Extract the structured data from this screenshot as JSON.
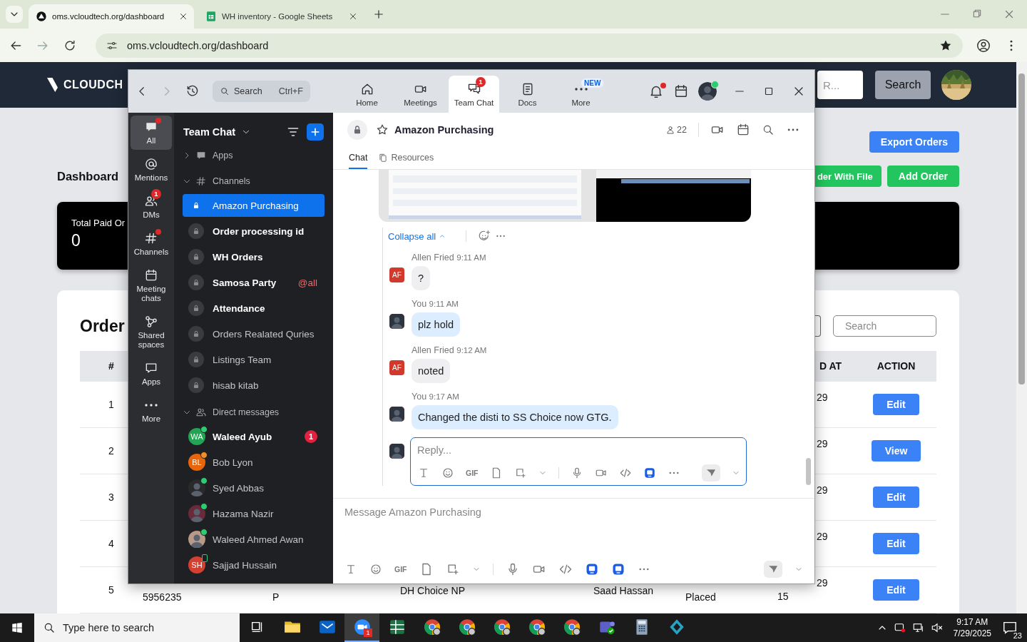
{
  "browser": {
    "tabs": [
      {
        "title": "oms.vcloudtech.org/dashboard",
        "selected": true
      },
      {
        "title": "WH inventory - Google Sheets",
        "selected": false
      }
    ],
    "address": "oms.vcloudtech.org/dashboard",
    "bookmarked": true
  },
  "dashboard": {
    "logo": "CLOUDCH",
    "header_search": {
      "placeholder": "R..."
    },
    "search_button": "Search",
    "title": "Dashboard",
    "buttons": [
      {
        "label": "Export Orders",
        "kind": "primary"
      },
      {
        "label": "der With File",
        "kind": "success"
      },
      {
        "label": "Add Order",
        "kind": "success"
      }
    ],
    "stat": {
      "label": "Total Paid Or",
      "value": "0"
    },
    "orders": {
      "title": "Order",
      "search": {
        "placeholder": "Search"
      },
      "columns": {
        "index": "#",
        "column_7": "D AT",
        "action": "ACTION"
      },
      "rows": [
        {
          "index": "1",
          "date": "29",
          "action": "Edit"
        },
        {
          "index": "2",
          "date": "29",
          "action": "View"
        },
        {
          "index": "3",
          "date": "29",
          "action": "Edit"
        },
        {
          "index": "4",
          "date": "29",
          "action": "Edit"
        },
        {
          "index": "5",
          "column_2": "5956235",
          "column_3": "P",
          "column_4": "DH Choice NP",
          "column_5": "Saad Hassan",
          "column_6": "Placed",
          "date": "29",
          "date_line_2": "15",
          "action": "Edit"
        }
      ]
    }
  },
  "zoom": {
    "titlebar": {
      "search": {
        "placeholder": "Search",
        "shortcut": "Ctrl+F"
      },
      "tabs": [
        {
          "label": "Home",
          "selected": false
        },
        {
          "label": "Meetings",
          "selected": false
        },
        {
          "label": "Team Chat",
          "selected": true,
          "badge": "1"
        },
        {
          "label": "Docs",
          "selected": false
        },
        {
          "label": "More",
          "selected": false,
          "tag": "NEW"
        }
      ],
      "notification_dot": true,
      "presence": {
        "kind": "dot",
        "color": "#2ecc71"
      }
    },
    "rail": [
      {
        "label": "All",
        "selected": true,
        "dot": true
      },
      {
        "label": "Mentions",
        "selected": false,
        "dot": false
      },
      {
        "label": "DMs",
        "selected": false,
        "dot": false,
        "badge": "1"
      },
      {
        "label": "Channels",
        "selected": false,
        "dot": true
      },
      {
        "label": "Meeting chats",
        "selected": false,
        "dot": false
      },
      {
        "label": "Shared spaces",
        "selected": false,
        "dot": false
      },
      {
        "label": "Apps",
        "selected": false,
        "dot": false
      },
      {
        "label": "More",
        "selected": false,
        "dot": false
      }
    ],
    "sidebar": {
      "title": "Team Chat",
      "sections": [
        {
          "label": "Apps",
          "expanded": false
        },
        {
          "label": "Channels",
          "expanded": true,
          "children": [
            {
              "name": "Amazon Purchasing",
              "selected": true,
              "unread": false
            },
            {
              "name": "Order processing id",
              "selected": false,
              "unread": true
            },
            {
              "name": "WH Orders",
              "selected": false,
              "unread": true
            },
            {
              "name": "Samosa Party",
              "selected": false,
              "unread": true,
              "mention": "@all"
            },
            {
              "name": "Attendance",
              "selected": false,
              "unread": true
            },
            {
              "name": "Orders Realated Quries",
              "selected": false,
              "unread": false
            },
            {
              "name": "Listings Team",
              "selected": false,
              "unread": false
            },
            {
              "name": "hisab kitab",
              "selected": false,
              "unread": false
            }
          ]
        },
        {
          "label": "Direct messages",
          "expanded": true,
          "children": [
            {
              "name": "Waleed Ayub",
              "initials": "WA",
              "color": "#23a455",
              "presence": {
                "kind": "dot",
                "color": "#2ecc71"
              },
              "selected": false,
              "unread": true,
              "badge": "1"
            },
            {
              "name": "Bob Lyon",
              "initials": "BL",
              "color": "#e8650a",
              "presence": {
                "kind": "dot",
                "color": "#f28c28"
              },
              "selected": false,
              "unread": false
            },
            {
              "name": "Syed Abbas",
              "color": "#2a2a2a",
              "presence": {
                "kind": "dot",
                "color": "#2ecc71"
              },
              "selected": false,
              "unread": false
            },
            {
              "name": "Hazama Nazir",
              "color": "#6b2a3a",
              "presence": {
                "kind": "dot",
                "color": "#2ecc71"
              },
              "selected": false,
              "unread": false
            },
            {
              "name": "Waleed Ahmed Awan",
              "color": "#b89a86",
              "presence": {
                "kind": "dot",
                "color": "#2ecc71"
              },
              "selected": false,
              "unread": false
            },
            {
              "name": "Sajjad Hussain",
              "initials": "SH",
              "color": "#d4402f",
              "presence": {
                "kind": "mobile",
                "color": "#2ecc71"
              },
              "selected": false,
              "unread": false
            }
          ]
        }
      ]
    },
    "chat": {
      "channel": "Amazon Purchasing",
      "members": "22",
      "tabs": [
        {
          "label": "Chat",
          "selected": true
        },
        {
          "label": "Resources",
          "selected": false
        }
      ],
      "collapse": "Collapse all",
      "messages": [
        {
          "sender": "Allen Fried",
          "time": "9:11 AM",
          "text": "?",
          "mine": false,
          "initials": "AF"
        },
        {
          "sender": "You",
          "time": "9:11 AM",
          "text": "plz hold",
          "mine": true
        },
        {
          "sender": "Allen Fried",
          "time": "9:12 AM",
          "text": "noted",
          "mine": false,
          "initials": "AF"
        },
        {
          "sender": "You",
          "time": "9:17 AM",
          "text": "Changed the disti to SS Choice now GTG.",
          "mine": true
        }
      ],
      "reply": {
        "placeholder": "Reply...",
        "gif": "GIF"
      },
      "composer": {
        "placeholder": "Message Amazon Purchasing",
        "gif": "GIF"
      }
    }
  },
  "taskbar": {
    "search": {
      "placeholder": "Type here to search"
    },
    "apps": [
      {
        "active": false
      },
      {
        "active": false
      },
      {
        "active": true,
        "badge": "1"
      },
      {
        "active": false
      },
      {
        "active": false
      },
      {
        "active": false
      },
      {
        "active": false
      },
      {
        "active": false
      },
      {
        "active": false
      },
      {
        "active": false
      },
      {
        "active": false
      },
      {
        "active": false
      }
    ],
    "time": "9:17 AM",
    "date": "7/29/2025",
    "notifications": "23"
  }
}
